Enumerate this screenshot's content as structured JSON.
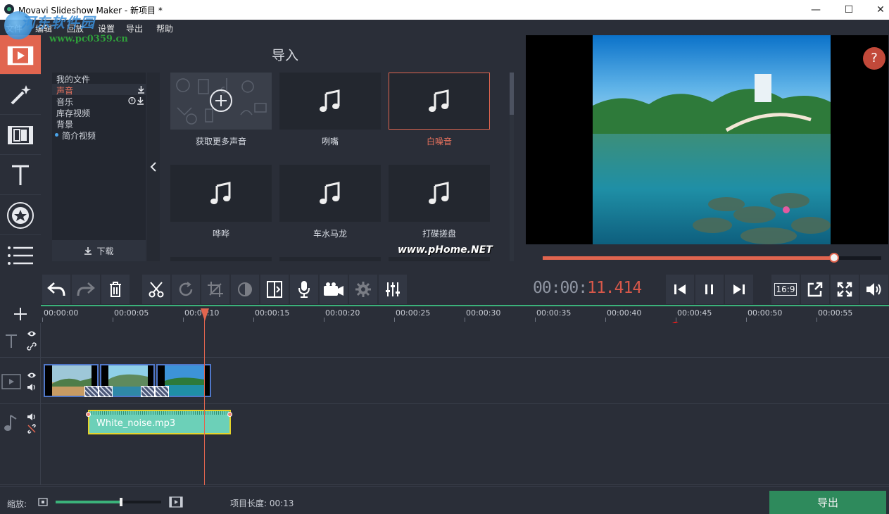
{
  "window": {
    "title": "Movavi Slideshow Maker - 新项目 *",
    "minimize": "—",
    "maximize": "☐",
    "close": "✕"
  },
  "menu": [
    "文件",
    "编辑",
    "回放",
    "设置",
    "导出",
    "帮助"
  ],
  "watermark": {
    "site_name": "河东软件园",
    "url": "www.pc0359.cn",
    "preview_mark": "www.pHome.NET"
  },
  "rail": {
    "items": [
      "import-icon",
      "magic-wand-icon",
      "transitions-icon",
      "text-icon",
      "stickers-icon",
      "more-icon"
    ],
    "active_index": 0
  },
  "import_panel": {
    "title": "导入",
    "library": [
      {
        "label": "我的文件",
        "selected": false
      },
      {
        "label": "声音",
        "selected": true
      },
      {
        "label": "音乐",
        "selected": false
      },
      {
        "label": "库存视频",
        "selected": false
      },
      {
        "label": "背景",
        "selected": false
      },
      {
        "label": "简介视频",
        "selected": false,
        "dot": true
      }
    ],
    "download_label": "下载",
    "tiles": [
      {
        "label": "获取更多声音",
        "kind": "more"
      },
      {
        "label": "咧嘴",
        "kind": "sound"
      },
      {
        "label": "白噪音",
        "kind": "sound",
        "selected": true
      },
      {
        "label": "哗哗",
        "kind": "sound"
      },
      {
        "label": "车水马龙",
        "kind": "sound"
      },
      {
        "label": "打碟搓盘",
        "kind": "sound"
      }
    ]
  },
  "player": {
    "time_base": "00:00:",
    "time_highlight": "11.414",
    "progress": 0.86,
    "aspect": "16:9",
    "help": "?"
  },
  "toolbar": {
    "buttons": [
      "undo-icon",
      "redo-icon",
      "delete-icon",
      "cut-icon",
      "rotate-icon",
      "crop-icon",
      "color-icon",
      "transition-icon",
      "mic-icon",
      "camera-icon",
      "settings-icon",
      "equalizer-icon"
    ]
  },
  "timeline": {
    "ticks": [
      "00:00:00",
      "00:00:05",
      "00:00:10",
      "00:00:15",
      "00:00:20",
      "00:00:25",
      "00:00:30",
      "00:00:35",
      "00:00:40",
      "00:00:45",
      "00:00:50",
      "00:00:55"
    ],
    "audio_clip": "White_noise.mp3"
  },
  "status": {
    "zoom_label": "缩放:",
    "zoom_level": 0.62,
    "project_length": "项目长度: 00:13",
    "export_label": "导出"
  },
  "colors": {
    "accent": "#e1654f",
    "timeline_green": "#3bb27a",
    "export_green": "#2e8a5c",
    "audio_clip": "#6cd0b8",
    "clip_border": "#5077c8"
  }
}
